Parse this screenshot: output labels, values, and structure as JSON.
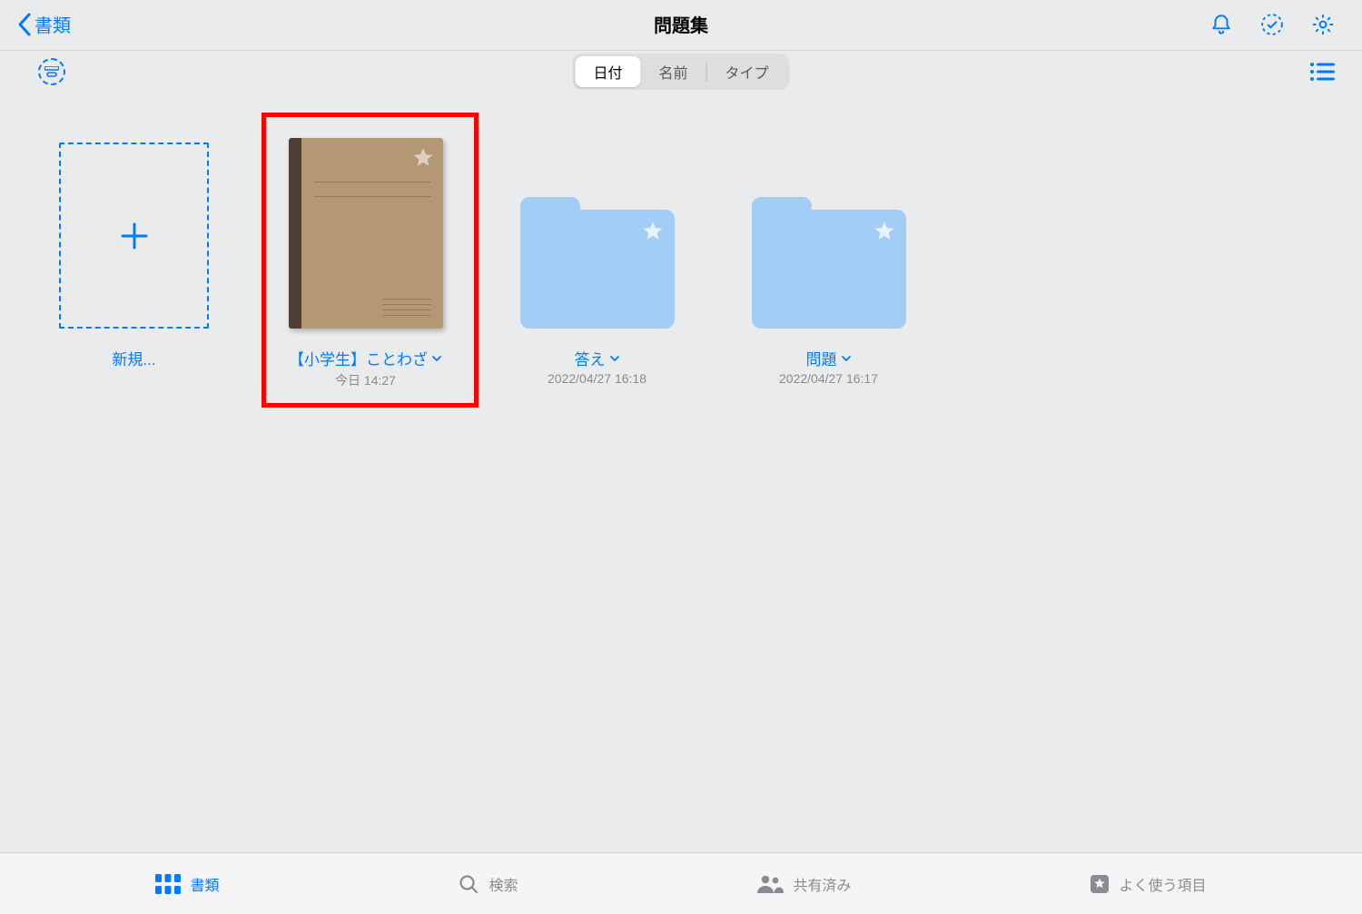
{
  "header": {
    "back_label": "書類",
    "title": "問題集"
  },
  "segmented": {
    "items": [
      "日付",
      "名前",
      "タイプ"
    ],
    "active_index": 0
  },
  "grid": {
    "new_label": "新規...",
    "items": [
      {
        "kind": "notebook",
        "title": "【小学生】ことわざ",
        "subtitle": "今日 14:27",
        "highlighted": true
      },
      {
        "kind": "folder",
        "title": "答え",
        "subtitle": "2022/04/27 16:18",
        "highlighted": false
      },
      {
        "kind": "folder",
        "title": "問題",
        "subtitle": "2022/04/27 16:17",
        "highlighted": false
      }
    ]
  },
  "tabbar": {
    "items": [
      {
        "icon": "grid",
        "label": "書類",
        "active": true
      },
      {
        "icon": "search",
        "label": "検索",
        "active": false
      },
      {
        "icon": "people",
        "label": "共有済み",
        "active": false
      },
      {
        "icon": "bookmark",
        "label": "よく使う項目",
        "active": false
      }
    ]
  },
  "colors": {
    "accent": "#007aff",
    "highlight": "#ff0000",
    "folder": "#a1cdf6",
    "notebook_cover": "#b49873",
    "notebook_spine": "#4f4031"
  }
}
